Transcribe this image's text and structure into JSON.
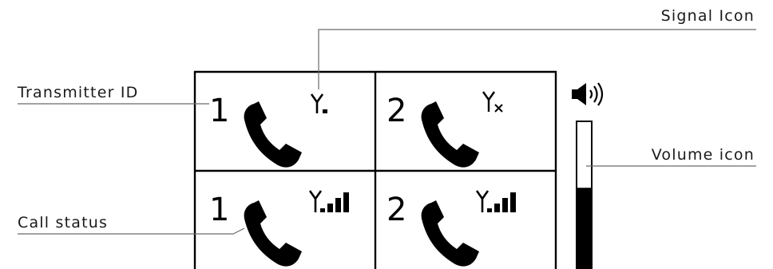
{
  "callouts": {
    "signal_icon": "Signal Icon",
    "transmitter_id": "Transmitter ID",
    "volume_icon": "Volume icon",
    "call_status": "Call status"
  },
  "tiles": [
    {
      "id": "1",
      "signal_icon": "antenna-weak-icon",
      "signal_bars": 1
    },
    {
      "id": "2",
      "signal_icon": "antenna-no-signal-icon",
      "signal_bars": 0
    },
    {
      "id": "1",
      "signal_icon": "antenna-full-icon",
      "signal_bars": 4
    },
    {
      "id": "2",
      "signal_icon": "antenna-full-icon",
      "signal_bars": 4
    }
  ],
  "volume": {
    "icon": "speaker-icon",
    "level": 0.55
  },
  "colors": {
    "ink": "#000000",
    "leader": "#6b6b6b"
  }
}
